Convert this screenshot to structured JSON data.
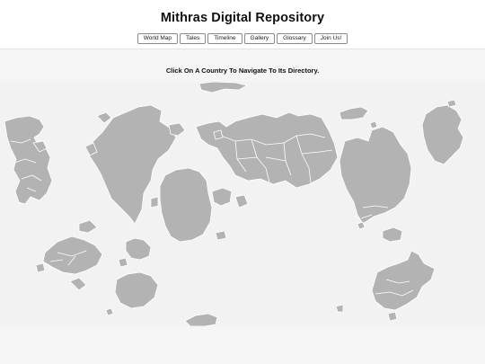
{
  "site": {
    "title": "Mithras Digital Repository"
  },
  "nav": {
    "items": [
      {
        "label": "World Map"
      },
      {
        "label": "Tales"
      },
      {
        "label": "Timeline"
      },
      {
        "label": "Gallery"
      },
      {
        "label": "Glossary"
      },
      {
        "label": "Join Us!"
      }
    ]
  },
  "map": {
    "instruction": "Click On A Country To Navigate To Its Directory.",
    "land_color": "#b3b3b3",
    "border_color": "#ffffff",
    "background_color": "#f2f2f2"
  }
}
